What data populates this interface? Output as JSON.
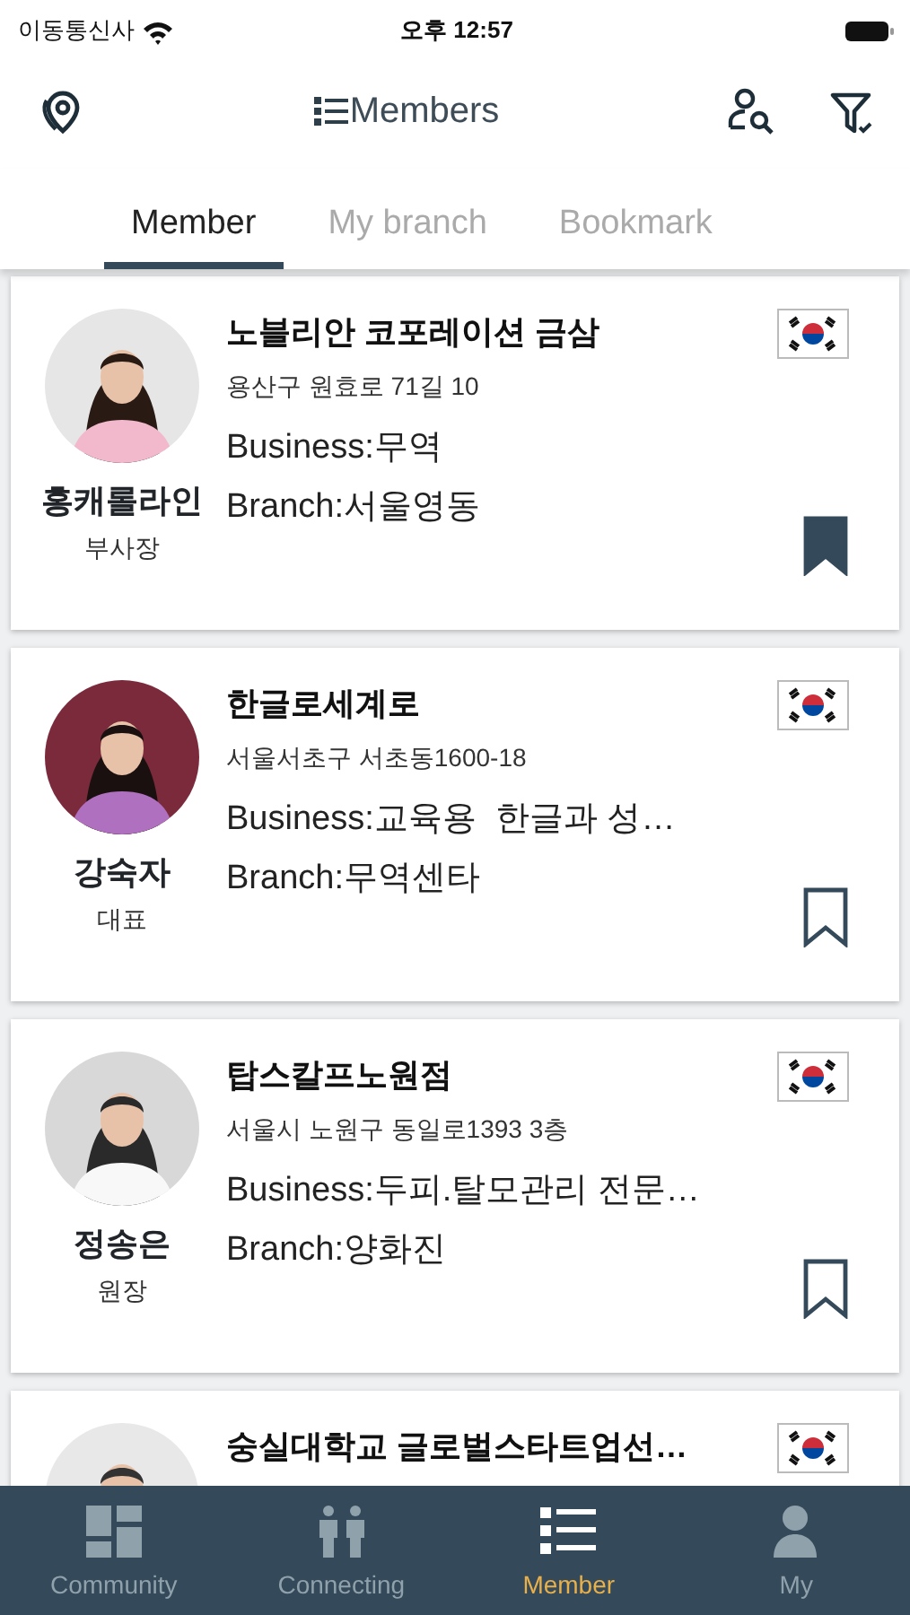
{
  "status_bar": {
    "carrier": "이동통신사",
    "time": "오후 12:57"
  },
  "header": {
    "title": "Members"
  },
  "tabs": [
    {
      "label": "Member",
      "selected": true
    },
    {
      "label": "My branch",
      "selected": false
    },
    {
      "label": "Bookmark",
      "selected": false
    }
  ],
  "members": [
    {
      "company": "노블리안 코포레이션 금삼",
      "address": "용산구 원효로 71길 10",
      "business": "Business:무역",
      "branch": "Branch:서울영동",
      "name": "홍캐롤라인",
      "position": "부사장",
      "bookmarked": true
    },
    {
      "company": "한글로세계로",
      "address": "서울서초구 서초동1600-18",
      "business": "Business:교육용  한글과 성…",
      "branch": "Branch:무역센타",
      "name": "강숙자",
      "position": "대표",
      "bookmarked": false
    },
    {
      "company": "탑스칼프노원점",
      "address": "서울시 노원구 동일로1393 3층",
      "business": "Business:두피.탈모관리 전문…",
      "branch": "Branch:양화진",
      "name": "정송은",
      "position": "원장",
      "bookmarked": false
    },
    {
      "company": "숭실대학교 글로벌스타트업선…"
    }
  ],
  "bottom_nav": [
    {
      "label": "Community",
      "kind": "dashboard",
      "selected": false
    },
    {
      "label": "Connecting",
      "kind": "people",
      "selected": false
    },
    {
      "label": "Member",
      "kind": "list",
      "selected": true
    },
    {
      "label": "My",
      "kind": "person",
      "selected": false
    }
  ]
}
